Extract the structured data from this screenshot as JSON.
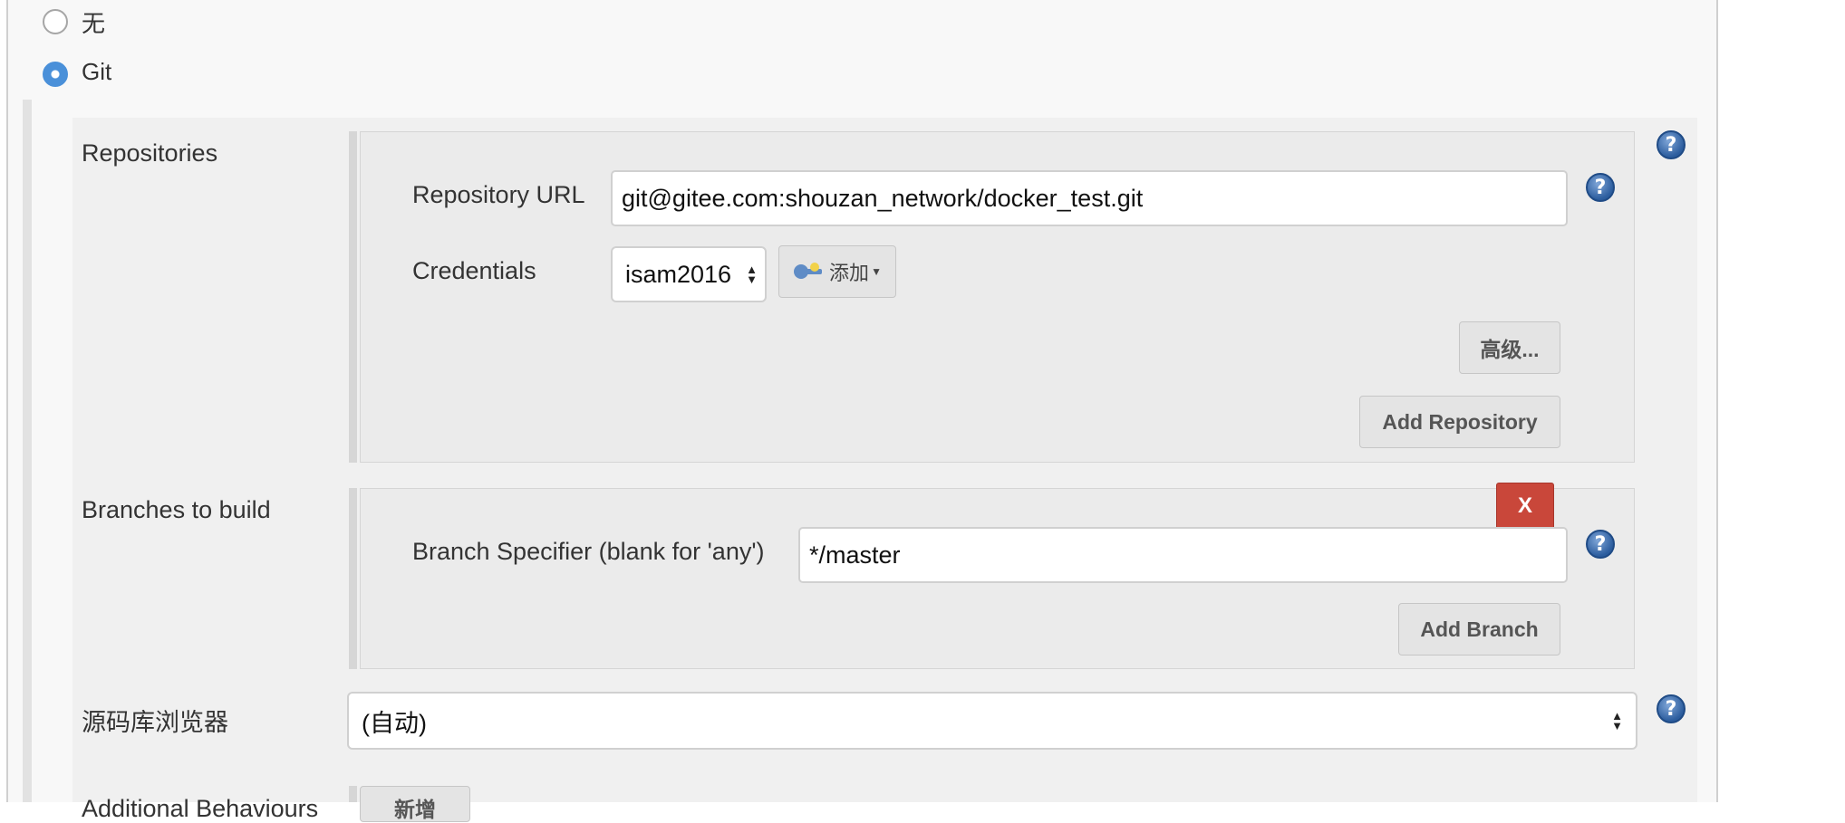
{
  "scm": {
    "options": [
      {
        "label": "无",
        "selected": false
      },
      {
        "label": "Git",
        "selected": true
      }
    ]
  },
  "repositories": {
    "label": "Repositories",
    "url_label": "Repository URL",
    "url_value": "git@gitee.com:shouzan_network/docker_test.git",
    "credentials_label": "Credentials",
    "credentials_value": "isam2016",
    "add_label": "添加",
    "advanced_label": "高级...",
    "add_repository_label": "Add Repository"
  },
  "branches": {
    "label": "Branches to build",
    "delete_label": "X",
    "specifier_label": "Branch Specifier (blank for 'any')",
    "specifier_value": "*/master",
    "add_branch_label": "Add Branch"
  },
  "browser": {
    "label": "源码库浏览器",
    "value": "(自动)"
  },
  "additional": {
    "label": "Additional Behaviours",
    "add_label": "新增"
  },
  "icons": {
    "help": "help-icon",
    "key": "key-icon",
    "dropdown": "dropdown-arrow-icon"
  },
  "colors": {
    "radio_selected": "#4a90d9",
    "delete_button": "#c9473a",
    "help_icon": "#2c5d9e"
  }
}
